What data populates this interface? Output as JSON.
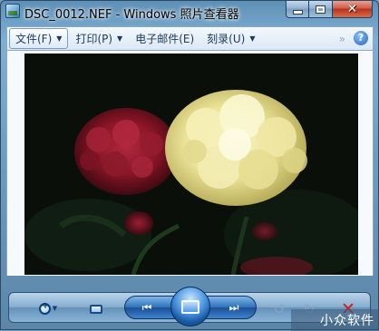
{
  "window": {
    "title": "DSC_0012.NEF - Windows 照片查看器"
  },
  "menu": {
    "items": [
      {
        "label": "文件(F)",
        "caret": "▼"
      },
      {
        "label": "打印(P)",
        "caret": "▼"
      },
      {
        "label": "电子邮件(E)",
        "caret": ""
      },
      {
        "label": "刻录(U)",
        "caret": "▼"
      }
    ],
    "overflow": "»",
    "help": "?"
  },
  "photo": {
    "subject": "red and yellow carnations"
  },
  "controls": {
    "zoom_caret": "▼",
    "prev_glyph": "⏮",
    "next_glyph": "⏭",
    "rotate_left_glyph": "↺",
    "rotate_right_glyph": "↻",
    "delete_glyph": "✕"
  },
  "watermark": "小众软件",
  "colors": {
    "accent": "#2c6fb8",
    "delete": "#d31b1b"
  }
}
